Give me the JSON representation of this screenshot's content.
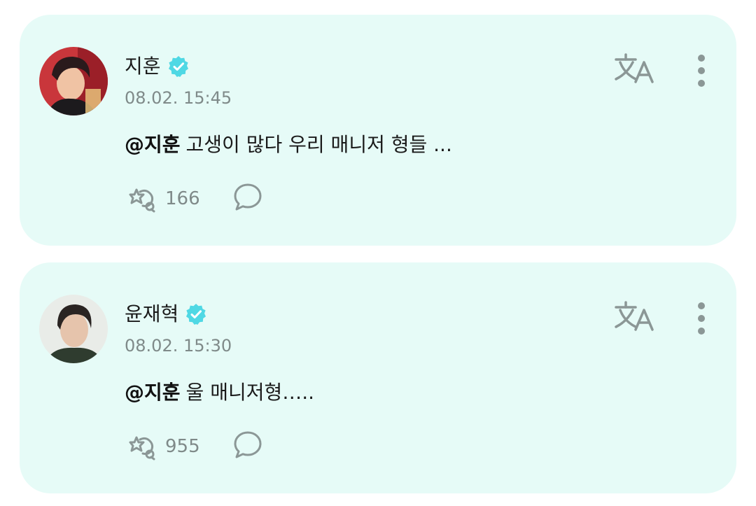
{
  "posts": [
    {
      "author": "지훈",
      "verified": true,
      "timestamp": "08.02. 15:45",
      "mention": "@지훈",
      "text": "고생이 많다 우리 매니저 형들 ...",
      "like_count": "166",
      "avatar_colors": {
        "background": "#c9363b",
        "accent": "#f2c4a2"
      }
    },
    {
      "author": "윤재혁",
      "verified": true,
      "timestamp": "08.02. 15:30",
      "mention": "@지훈",
      "text": "울 매니저형…..",
      "like_count": "955",
      "avatar_colors": {
        "background": "#e9ece8",
        "accent": "#2f3c2f"
      }
    }
  ],
  "colors": {
    "card_background": "#e6fbf7",
    "verified_badge": "#4fd8e4",
    "icon_gray": "#8b9796",
    "muted_text": "#7f8a89"
  },
  "icons": {
    "verified": "verified-check-icon",
    "translate": "translate-icon",
    "more": "more-vertical-icon",
    "like": "sparkle-hand-icon",
    "comment": "comment-bubble-icon"
  }
}
